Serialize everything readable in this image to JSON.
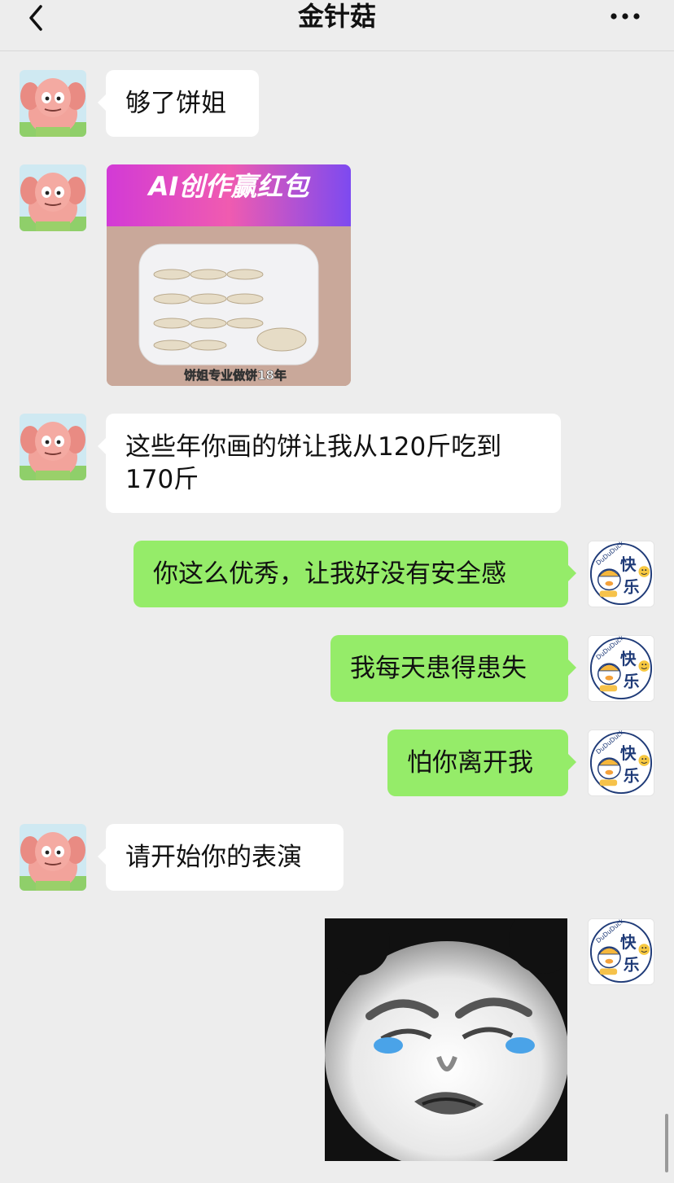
{
  "header": {
    "title": "金针菇",
    "back_icon": "chevron-left-icon",
    "more_icon": "more-dots-icon"
  },
  "colors": {
    "background": "#ededed",
    "incoming_bubble": "#ffffff",
    "outgoing_bubble": "#95ec69"
  },
  "messages": [
    {
      "side": "in",
      "type": "text",
      "text": "够了饼姐"
    },
    {
      "side": "in",
      "type": "image",
      "caption_top": "AI创作赢红包",
      "caption_bottom": "饼姐专业做饼18年"
    },
    {
      "side": "in",
      "type": "text",
      "text": "这些年你画的饼让我从120斤吃到\n170斤"
    },
    {
      "side": "out",
      "type": "text",
      "text": "你这么优秀，让我好没有安全感"
    },
    {
      "side": "out",
      "type": "text",
      "text": "我每天患得患失"
    },
    {
      "side": "out",
      "type": "text",
      "text": "怕你离开我"
    },
    {
      "side": "in",
      "type": "text",
      "text": "请开始你的表演"
    },
    {
      "side": "out",
      "type": "sticker",
      "sticker": "crying-panda-face-sticker"
    }
  ],
  "avatars": {
    "contact": "patrick-star-avatar",
    "self_text_1": "快乐",
    "self_text_2": "DuDuDuck",
    "self_text_3": "ing"
  }
}
